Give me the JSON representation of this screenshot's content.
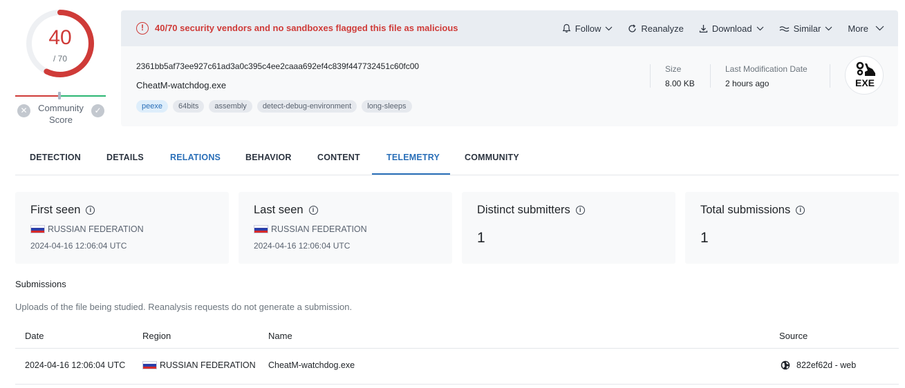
{
  "score": {
    "detected": "40",
    "total": "/ 70",
    "fraction": 0.571,
    "community_label": "Community Score",
    "colors": {
      "danger": "#cf3b38",
      "ok": "#2bb673"
    }
  },
  "alert": {
    "text": "40/70 security vendors and no sandboxes flagged this file as malicious"
  },
  "actions": [
    {
      "label": "Follow",
      "icon": "bell-icon"
    },
    {
      "label": "Reanalyze",
      "icon": "refresh-icon"
    },
    {
      "label": "Download",
      "icon": "download-icon"
    },
    {
      "label": "Similar",
      "icon": "similar-icon"
    },
    {
      "label": "More",
      "icon": "chevron-down-icon"
    }
  ],
  "file": {
    "hash": "2361bb5af73ee927c61ad3a0c395c4ee2caaa692ef4c839f447732451c60fc00",
    "name": "CheatM-watchdog.exe",
    "tags": [
      "peexe",
      "64bits",
      "assembly",
      "detect-debug-environment",
      "long-sleeps"
    ],
    "size_label": "Size",
    "size_value": "8.00 KB",
    "modified_label": "Last Modification Date",
    "modified_value": "2 hours ago",
    "type_badge": "EXE"
  },
  "tabs": [
    {
      "label": "DETECTION"
    },
    {
      "label": "DETAILS"
    },
    {
      "label": "RELATIONS"
    },
    {
      "label": "BEHAVIOR"
    },
    {
      "label": "CONTENT"
    },
    {
      "label": "TELEMETRY"
    },
    {
      "label": "COMMUNITY"
    }
  ],
  "stats": {
    "first_seen": {
      "title": "First seen",
      "region": "RUSSIAN FEDERATION",
      "date": "2024-04-16 12:06:04 UTC"
    },
    "last_seen": {
      "title": "Last seen",
      "region": "RUSSIAN FEDERATION",
      "date": "2024-04-16 12:06:04 UTC"
    },
    "distinct_submitters": {
      "title": "Distinct submitters",
      "value": "1"
    },
    "total_submissions": {
      "title": "Total submissions",
      "value": "1"
    }
  },
  "submissions": {
    "title": "Submissions",
    "description": "Uploads of the file being studied. Reanalysis requests do not generate a submission.",
    "columns": [
      "Date",
      "Region",
      "Name",
      "Source"
    ],
    "rows": [
      {
        "date": "2024-04-16 12:06:04 UTC",
        "region": "RUSSIAN FEDERATION",
        "name": "CheatM-watchdog.exe",
        "source": "822ef62d - web"
      }
    ]
  }
}
